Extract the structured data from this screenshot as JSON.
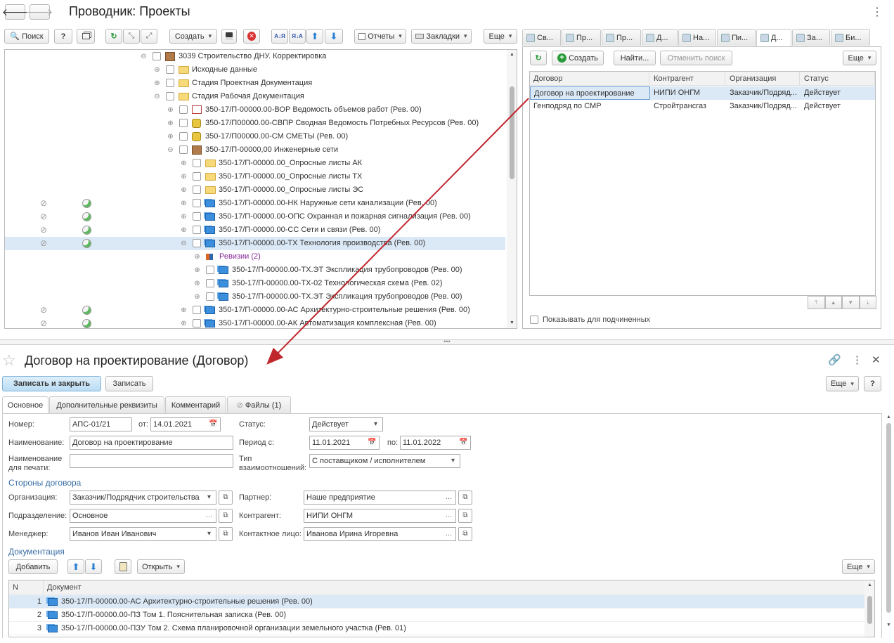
{
  "window": {
    "title": "Проводник: Проекты"
  },
  "toolbar": {
    "search": "Поиск",
    "help": "?",
    "create": "Создать",
    "reports": "Отчеты",
    "bookmarks": "Закладки",
    "more": "Еще"
  },
  "tree": [
    {
      "label": "3039 Строительство ДНУ. Корректировка",
      "level": 0,
      "exp": "⊖",
      "icon": "box-icon"
    },
    {
      "label": "Исходные данные",
      "level": 1,
      "exp": "⊕",
      "icon": "folder-icon"
    },
    {
      "label": "Стадия Проектная Документация",
      "level": 1,
      "exp": "⊕",
      "icon": "folder-icon"
    },
    {
      "label": "Стадия Рабочая Документация",
      "level": 1,
      "exp": "⊖",
      "icon": "folder-icon"
    },
    {
      "label": "350-17/П-00000.00-ВОР Ведомость объемов работ (Рев. 00)",
      "level": 2,
      "exp": "⊕",
      "icon": "estimate-icon"
    },
    {
      "label": "350-17/П00000.00-СВПР Сводная Ведомость Потребных Ресурсов (Рев. 00)",
      "level": 2,
      "exp": "⊕",
      "icon": "coins-icon"
    },
    {
      "label": "350-17/П00000.00-СМ СМЕТЫ (Рев. 00)",
      "level": 2,
      "exp": "⊕",
      "icon": "coins-icon"
    },
    {
      "label": "350-17/П-00000,00 Инженерные сети",
      "level": 2,
      "exp": "⊖",
      "icon": "box-icon"
    },
    {
      "label": "350-17/П-00000.00_Опросные листы АК",
      "level": 3,
      "exp": "⊕",
      "icon": "folder-icon"
    },
    {
      "label": "350-17/П-00000.00_Опросные листы ТХ",
      "level": 3,
      "exp": "⊕",
      "icon": "folder-icon"
    },
    {
      "label": "350-17/П-00000.00_Опросные листы ЭС",
      "level": 3,
      "exp": "⊕",
      "icon": "folder-icon"
    },
    {
      "label": "350-17/П-00000.00-НК Наружные сети канализации  (Рев. 00)",
      "level": 3,
      "exp": "⊕",
      "icon": "doc-icon",
      "attach": true
    },
    {
      "label": "350-17/П-00000.00-ОПС Охранная и пожарная сигнализация (Рев. 00)",
      "level": 3,
      "exp": "⊕",
      "icon": "doc-icon",
      "attach": true
    },
    {
      "label": "350-17/П-00000.00-СС Сети и связи (Рев. 00)",
      "level": 3,
      "exp": "⊕",
      "icon": "doc-icon",
      "attach": true
    },
    {
      "label": "350-17/П-00000.00-ТХ Технология производства (Рев. 00)",
      "level": 3,
      "exp": "⊖",
      "icon": "doc-icon",
      "attach": true,
      "selected": true
    },
    {
      "label": "Ревизии (2)",
      "level": 4,
      "exp": "⊕",
      "icon": "revisions-icon",
      "nocheck": true,
      "purple": true
    },
    {
      "label": "350-17/П-00000.00-ТХ.ЭТ Экспликация трубопроводов (Рев. 00)",
      "level": 4,
      "exp": "⊕",
      "icon": "doc-icon"
    },
    {
      "label": "350-17/П-00000.00-ТХ-02 Технологическая схема (Рев. 02)",
      "level": 4,
      "exp": "⊕",
      "icon": "doc-icon"
    },
    {
      "label": "350-17/П-00000.00-ТХ.ЭТ Экспликация трубопроводов (Рев. 00)",
      "level": 4,
      "exp": "⊕",
      "icon": "doc-icon"
    },
    {
      "label": "350-17/П-00000.00-АС Архитектурно-строительные решения (Рев. 00)",
      "level": 3,
      "exp": "⊕",
      "icon": "doc-icon",
      "attach": true
    },
    {
      "label": "350-17/П-00000.00-АК Автоматизация комплексная (Рев. 00)",
      "level": 3,
      "exp": "⊕",
      "icon": "doc-icon",
      "attach": true
    }
  ],
  "right_tabs": [
    "Св...",
    "Пр...",
    "Пр...",
    "Д...",
    "На...",
    "Пи...",
    "Д...",
    "За...",
    "Би..."
  ],
  "right_tabs_icons": [
    "info-icon",
    "users-icon",
    "key-icon",
    "book-icon",
    "notice-icon",
    "pen-icon",
    "copy-icon",
    "notes-icon",
    "people-icon"
  ],
  "contracts": {
    "create": "Создать",
    "find": "Найти...",
    "cancel_search": "Отменить поиск",
    "more": "Еще",
    "columns": [
      "Договор",
      "Контрагент",
      "Организация",
      "Статус"
    ],
    "rows": [
      [
        "Договор на проектирование",
        "НИПИ ОНГМ",
        "Заказчик/Подряд...",
        "Действует"
      ],
      [
        "Генподряд по СМР",
        "Стройтрансгаз",
        "Заказчик/Подряд...",
        "Действует"
      ]
    ],
    "show_sub": "Показывать для подчиненных"
  },
  "form": {
    "title": "Договор на проектирование (Договор)",
    "save_close": "Записать и закрыть",
    "save": "Записать",
    "more": "Еще",
    "help": "?",
    "tabs": [
      "Основное",
      "Дополнительные реквизиты",
      "Комментарий",
      "Файлы (1)"
    ],
    "number_label": "Номер:",
    "number": "АПС-01/21",
    "from_label": "от:",
    "date": "14.01.2021",
    "status_label": "Статус:",
    "status": "Действует",
    "name_label": "Наименование:",
    "name": "Договор на проектирование",
    "period_label": "Период с:",
    "period_from": "11.01.2021",
    "to_label": "по:",
    "period_to": "11.01.2022",
    "print_name_label": "Наименование\nдля печати:",
    "print_name": "",
    "relation_label": "Тип\nвзаимоотношений:",
    "relation": "С поставщиком / исполнителем",
    "parties_title": "Стороны договора",
    "org_label": "Организация:",
    "org": "Заказчик/Подрядчик строительства",
    "partner_label": "Партнер:",
    "partner": "Наше предприятие",
    "dept_label": "Подразделение:",
    "dept": "Основное",
    "counterparty_label": "Контрагент:",
    "counterparty": "НИПИ ОНГМ",
    "manager_label": "Менеджер:",
    "manager": "Иванов Иван Иванович",
    "contact_label": "Контактное лицо:",
    "contact": "Иванова Ирина Игоревна",
    "docs_title": "Документация",
    "add": "Добавить",
    "open": "Открыть",
    "docs_more": "Еще",
    "docs_columns": [
      "N",
      "Документ"
    ],
    "docs": [
      {
        "n": "1",
        "name": "350-17/П-00000.00-АС Архитектурно-строительные решения (Рев. 00)"
      },
      {
        "n": "2",
        "name": "350-17/П-00000.00-ПЗ Том 1. Пояснительная записка (Рев. 00)"
      },
      {
        "n": "3",
        "name": "350-17/П-00000.00-ПЗУ Том 2. Схема планировочной организации земельного участка (Рев. 01)"
      }
    ]
  },
  "colors": {
    "accent": "#3a6ea5",
    "selection": "#dbe8f6",
    "arrow": "#c0272d"
  }
}
